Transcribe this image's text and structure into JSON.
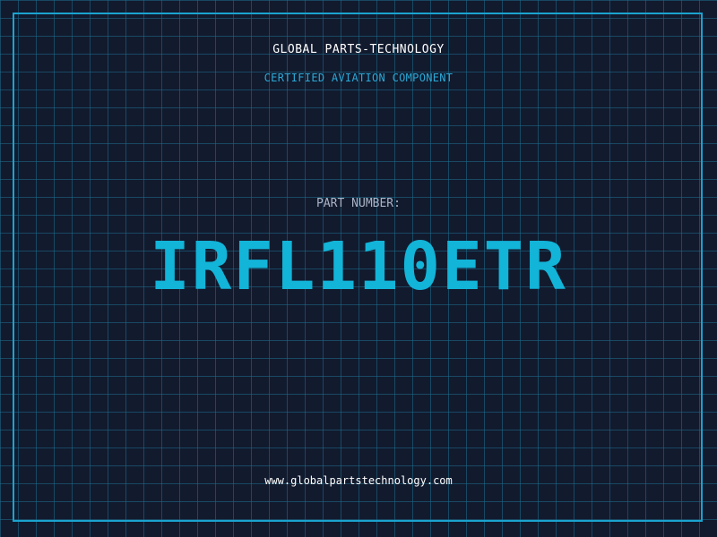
{
  "header": {
    "company": "GLOBAL PARTS-TECHNOLOGY",
    "tagline": "CERTIFIED AVIATION COMPONENT"
  },
  "part": {
    "label": "PART NUMBER:",
    "number": "IRFL110ETR"
  },
  "footer": {
    "website": "www.globalpartstechnology.com"
  },
  "colors": {
    "background": "#121a2e",
    "grid": "#1e6e8c",
    "accent": "#12b4d8",
    "frame": "#1aa3cf"
  }
}
